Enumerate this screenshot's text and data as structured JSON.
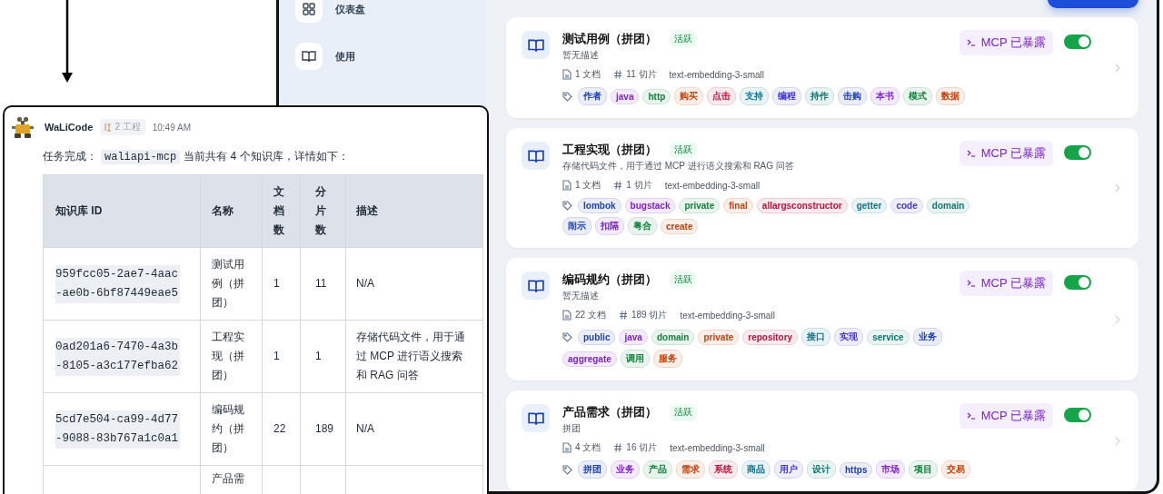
{
  "sidebar": {
    "items": [
      {
        "label": "仪表盘"
      },
      {
        "label": "使用"
      }
    ]
  },
  "cards": [
    {
      "title": "测试用例（拼团）",
      "status": "活跃",
      "description": "暂无描述",
      "docs": "1 文档",
      "chunks": "11 切片",
      "model": "text-embedding-3-small",
      "mcp_badge": "MCP 已暴露",
      "on": true,
      "tags": [
        {
          "label": "作者",
          "color": "#1e40af"
        },
        {
          "label": "java",
          "color": "#7e22ce"
        },
        {
          "label": "http",
          "color": "#15803d"
        },
        {
          "label": "购买",
          "color": "#c2410c"
        },
        {
          "label": "点击",
          "color": "#be123c"
        },
        {
          "label": "支持",
          "color": "#0e7490"
        },
        {
          "label": "编程",
          "color": "#4338ca"
        },
        {
          "label": "持作",
          "color": "#0f766e"
        },
        {
          "label": "击购",
          "color": "#1e40af"
        },
        {
          "label": "本书",
          "color": "#7e22ce"
        },
        {
          "label": "模式",
          "color": "#15803d"
        },
        {
          "label": "数据",
          "color": "#c2410c"
        }
      ]
    },
    {
      "title": "工程实现（拼团）",
      "status": "活跃",
      "description": "存储代码文件，用于通过 MCP 进行语义搜索和 RAG 问答",
      "docs": "1 文档",
      "chunks": "1 切片",
      "model": "text-embedding-3-small",
      "mcp_badge": "MCP 已暴露",
      "on": true,
      "tags": [
        {
          "label": "lombok",
          "color": "#1e40af"
        },
        {
          "label": "bugstack",
          "color": "#7e22ce"
        },
        {
          "label": "private",
          "color": "#15803d"
        },
        {
          "label": "final",
          "color": "#c2410c"
        },
        {
          "label": "allargsconstructor",
          "color": "#be123c"
        },
        {
          "label": "getter",
          "color": "#0e7490"
        },
        {
          "label": "code",
          "color": "#4338ca"
        },
        {
          "label": "domain",
          "color": "#0f766e"
        },
        {
          "label": "闹示",
          "color": "#1e40af"
        },
        {
          "label": "扣隔",
          "color": "#7e22ce"
        },
        {
          "label": "粤合",
          "color": "#15803d"
        },
        {
          "label": "create",
          "color": "#c2410c"
        }
      ]
    },
    {
      "title": "编码规约（拼团）",
      "status": "活跃",
      "description": "暂无描述",
      "docs": "22 文档",
      "chunks": "189 切片",
      "model": "text-embedding-3-small",
      "mcp_badge": "MCP 已暴露",
      "on": true,
      "tags": [
        {
          "label": "public",
          "color": "#1e40af"
        },
        {
          "label": "java",
          "color": "#7e22ce"
        },
        {
          "label": "domain",
          "color": "#15803d"
        },
        {
          "label": "private",
          "color": "#c2410c"
        },
        {
          "label": "repository",
          "color": "#be123c"
        },
        {
          "label": "接口",
          "color": "#0e7490"
        },
        {
          "label": "实现",
          "color": "#4338ca"
        },
        {
          "label": "service",
          "color": "#0f766e"
        },
        {
          "label": "业务",
          "color": "#1e40af"
        },
        {
          "label": "aggregate",
          "color": "#7e22ce"
        },
        {
          "label": "调用",
          "color": "#15803d"
        },
        {
          "label": "服务",
          "color": "#c2410c"
        }
      ]
    },
    {
      "title": "产品需求（拼团）",
      "status": "活跃",
      "description": "拼团",
      "docs": "4 文档",
      "chunks": "16 切片",
      "model": "text-embedding-3-small",
      "mcp_badge": "MCP 已暴露",
      "on": true,
      "tags": [
        {
          "label": "拼团",
          "color": "#1e40af"
        },
        {
          "label": "业务",
          "color": "#7e22ce"
        },
        {
          "label": "产品",
          "color": "#15803d"
        },
        {
          "label": "需求",
          "color": "#c2410c"
        },
        {
          "label": "系统",
          "color": "#be123c"
        },
        {
          "label": "商品",
          "color": "#0e7490"
        },
        {
          "label": "用户",
          "color": "#4338ca"
        },
        {
          "label": "设计",
          "color": "#0f766e"
        },
        {
          "label": "https",
          "color": "#1e40af"
        },
        {
          "label": "市场",
          "color": "#7e22ce"
        },
        {
          "label": "项目",
          "color": "#15803d"
        },
        {
          "label": "交易",
          "color": "#c2410c"
        }
      ]
    }
  ],
  "chat": {
    "sender": "WaLiCode",
    "badge": "2 工程",
    "time": "10:49 AM",
    "message": {
      "prefix": "任务完成：",
      "code": "waliapi-mcp",
      "suffix": "当前共有 4 个知识库，详情如下："
    },
    "table": {
      "columns": [
        "知识库 ID",
        "名称",
        "文档数",
        "分片数",
        "描述"
      ],
      "rows": [
        {
          "id": "959fcc05-2ae7-4aac-ae0b-6bf87449eae5",
          "name": "测试用例（拼团）",
          "docs": "1",
          "chunks": "11",
          "description": "N/A"
        },
        {
          "id": "0ad201a6-7470-4a3b-8105-a3c177efba62",
          "name": "工程实现（拼团）",
          "docs": "1",
          "chunks": "1",
          "description": "存储代码文件，用于通过 MCP 进行语义搜索和 RAG 问答"
        },
        {
          "id": "5cd7e504-ca99-4d77-9088-83b767a1c0a1",
          "name": "编码规约（拼团）",
          "docs": "22",
          "chunks": "189",
          "description": "N/A"
        },
        {
          "name": "产品需"
        }
      ]
    }
  }
}
